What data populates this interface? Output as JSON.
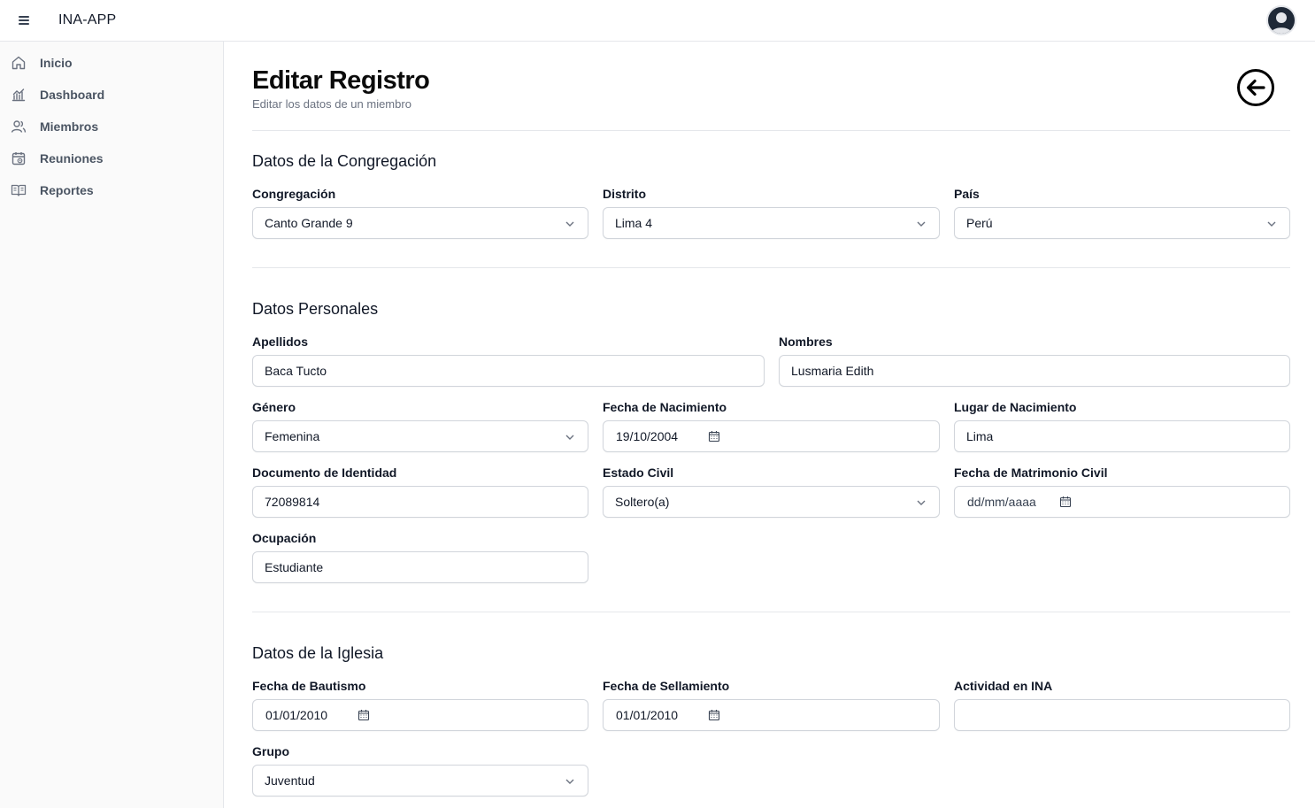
{
  "app": {
    "title": "INA-APP"
  },
  "sidebar": {
    "items": [
      {
        "label": "Inicio",
        "icon": "home-icon"
      },
      {
        "label": "Dashboard",
        "icon": "chart-icon"
      },
      {
        "label": "Miembros",
        "icon": "users-icon"
      },
      {
        "label": "Reuniones",
        "icon": "calendar-icon"
      },
      {
        "label": "Reportes",
        "icon": "book-icon"
      }
    ]
  },
  "page": {
    "title": "Editar Registro",
    "subtitle": "Editar los datos de un miembro"
  },
  "congregacion": {
    "title": "Datos de la Congregación",
    "congregacion": {
      "label": "Congregación",
      "value": "Canto Grande 9"
    },
    "distrito": {
      "label": "Distrito",
      "value": "Lima 4"
    },
    "pais": {
      "label": "País",
      "value": "Perú"
    }
  },
  "personales": {
    "title": "Datos Personales",
    "apellidos": {
      "label": "Apellidos",
      "value": "Baca Tucto"
    },
    "nombres": {
      "label": "Nombres",
      "value": "Lusmaria Edith"
    },
    "genero": {
      "label": "Género",
      "value": "Femenina"
    },
    "fecha_nacimiento": {
      "label": "Fecha de Nacimiento",
      "value": "19/10/2004"
    },
    "lugar_nacimiento": {
      "label": "Lugar de Nacimiento",
      "value": "Lima"
    },
    "documento": {
      "label": "Documento de Identidad",
      "value": "72089814"
    },
    "estado_civil": {
      "label": "Estado Civil",
      "value": "Soltero(a)"
    },
    "fecha_matrimonio": {
      "label": "Fecha de Matrimonio Civil",
      "value": "",
      "placeholder": "dd/mm/aaaa"
    },
    "ocupacion": {
      "label": "Ocupación",
      "value": "Estudiante"
    }
  },
  "iglesia": {
    "title": "Datos de la Iglesia",
    "fecha_bautismo": {
      "label": "Fecha de Bautismo",
      "value": "01/01/2010"
    },
    "fecha_sellamiento": {
      "label": "Fecha de Sellamiento",
      "value": "01/01/2010"
    },
    "actividad": {
      "label": "Actividad en INA",
      "value": ""
    },
    "grupo": {
      "label": "Grupo",
      "value": "Juventud"
    }
  }
}
